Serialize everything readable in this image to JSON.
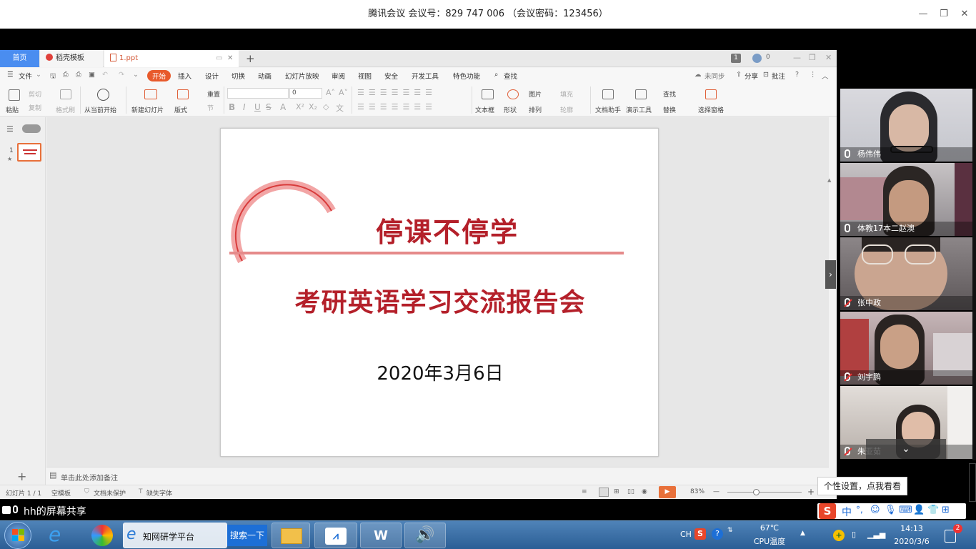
{
  "meeting": {
    "title": "腾讯会议 会议号：829 747 006 （会议密码：123456）",
    "minimize": "—",
    "restore": "❐",
    "close": "✕"
  },
  "tabs": {
    "home": "首页",
    "template": "稻壳模板",
    "file": "1.ppt",
    "add": "+",
    "badge": "1",
    "count": "0"
  },
  "menu": {
    "file": "文件",
    "items": [
      "开始",
      "插入",
      "设计",
      "切换",
      "动画",
      "幻灯片放映",
      "审阅",
      "视图",
      "安全",
      "开发工具",
      "特色功能"
    ],
    "search": "查找",
    "sync": "未同步",
    "share": "分享",
    "annotate": "批注"
  },
  "ribbon": {
    "paste": "粘贴",
    "cut": "剪切",
    "copy": "复制",
    "format_painter": "格式刷",
    "from_current": "从当前开始",
    "new_slide": "新建幻灯片",
    "layout": "版式",
    "section": "节",
    "reset": "重置",
    "font_size": "0",
    "textbox": "文本框",
    "shape": "形状",
    "arrange": "排列",
    "picture": "图片",
    "fill": "填充",
    "outline": "轮廓",
    "doc_helper": "文档助手",
    "present_tools": "演示工具",
    "find": "查找",
    "replace": "替换",
    "select_pane": "选择窗格"
  },
  "slide": {
    "title": "停课不停学",
    "subtitle": "考研英语学习交流报告会",
    "date": "2020年3月6日",
    "number": "1"
  },
  "notes": {
    "placeholder": "单击此处添加备注",
    "add": "+"
  },
  "status": {
    "slide_pos": "幻灯片 1 / 1",
    "template": "空模板",
    "protect": "文档未保护",
    "missing_font": "缺失字体",
    "zoom": "83%",
    "minus": "—",
    "plus": "+"
  },
  "participants": [
    {
      "name": "杨伟伟",
      "muted": false
    },
    {
      "name": "体教17本二赵澳",
      "muted": false
    },
    {
      "name": "张中政",
      "muted": true
    },
    {
      "name": "刘宇鹏",
      "muted": true
    },
    {
      "name": "朱亚茹",
      "muted": true
    }
  ],
  "share": {
    "label": "hh的屏幕共享",
    "tooltip": "个性设置，点我看看"
  },
  "taskbar": {
    "ie_title": "知网研学平台",
    "search_btn": "搜索一下",
    "lang": "CH",
    "temp": "67℃",
    "temp_label": "CPU温度",
    "time": "14:13",
    "date": "2020/3/6",
    "notif": "2",
    "ime_mode": "中",
    "ime_punct": "°,"
  }
}
